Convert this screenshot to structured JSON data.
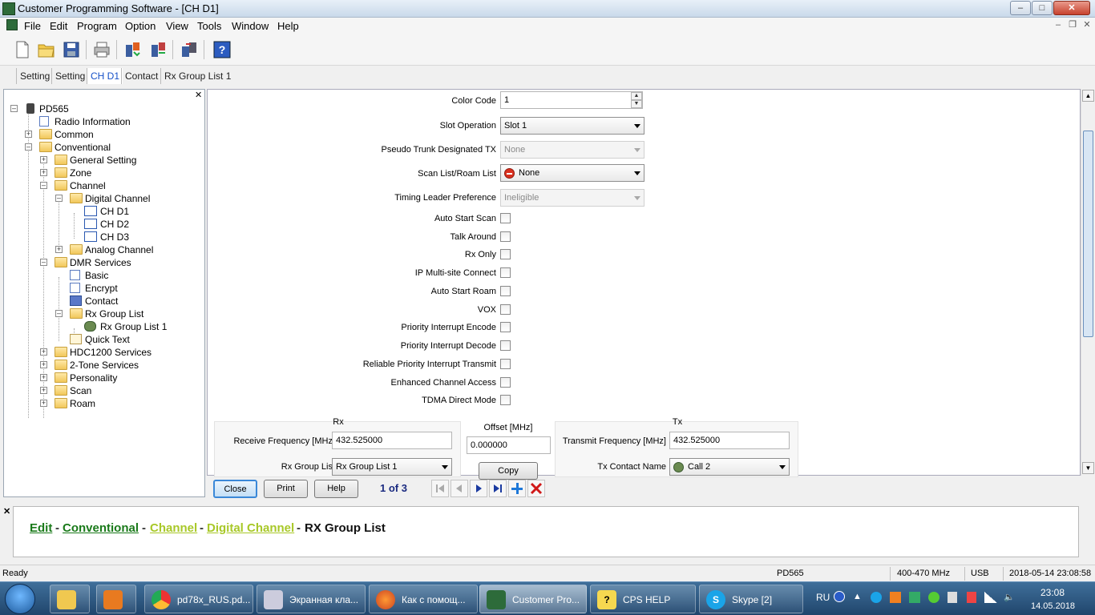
{
  "window": {
    "title": "Customer Programming Software - [CH D1]"
  },
  "menu": [
    "File",
    "Edit",
    "Program",
    "Option",
    "View",
    "Tools",
    "Window",
    "Help"
  ],
  "toolbar_icons": [
    "new-file-icon",
    "open-folder-icon",
    "save-icon",
    "print-icon",
    "read-radio-icon",
    "write-radio-icon",
    "clone-icon",
    "help-icon"
  ],
  "doc_tabs": [
    "Setting",
    "Setting",
    "CH D1",
    "Contact",
    "Rx Group List 1"
  ],
  "tree": {
    "root": "PD565",
    "nodes": [
      "Radio Information",
      "Common",
      "Conventional",
      "General Setting",
      "Zone",
      "Channel",
      "Digital Channel",
      "CH D1",
      "CH D2",
      "CH D3",
      "Analog Channel",
      "DMR Services",
      "Basic",
      "Encrypt",
      "Contact",
      "Rx Group List",
      "Rx Group List 1",
      "Quick Text",
      "HDC1200 Services",
      "2-Tone Services",
      "Personality",
      "Scan",
      "Roam"
    ]
  },
  "form": {
    "color_code_label": "Color Code",
    "color_code_value": "1",
    "slot_operation_label": "Slot Operation",
    "slot_operation_value": "Slot 1",
    "pseudo_trunk_label": "Pseudo Trunk Designated TX",
    "pseudo_trunk_value": "None",
    "scan_list_label": "Scan List/Roam List",
    "scan_list_value": "None",
    "timing_leader_label": "Timing Leader Preference",
    "timing_leader_value": "Ineligible",
    "checkboxes": [
      "Auto Start Scan",
      "Talk Around",
      "Rx Only",
      "IP Multi-site Connect",
      "Auto Start Roam",
      "VOX",
      "Priority Interrupt Encode",
      "Priority Interrupt Decode",
      "Reliable Priority Interrupt Transmit",
      "Enhanced Channel Access",
      "TDMA Direct Mode"
    ],
    "rx_title": "Rx",
    "rx_freq_label": "Receive Frequency [MHz]",
    "rx_freq_value": "432.525000",
    "rx_group_label": "Rx Group List",
    "rx_group_value": "Rx Group List 1",
    "offset_title": "Offset [MHz]",
    "offset_value": "0.000000",
    "copy_label": "Copy",
    "tx_title": "Tx",
    "tx_freq_label": "Transmit Frequency [MHz]",
    "tx_freq_value": "432.525000",
    "tx_contact_label": "Tx Contact Name",
    "tx_contact_value": "Call 2"
  },
  "buttons": {
    "close": "Close",
    "print": "Print",
    "help": "Help",
    "pager": "1 of 3"
  },
  "breadcrumb": {
    "edit": "Edit",
    "conventional": "Conventional",
    "channel": "Channel",
    "digital_channel": "Digital Channel",
    "current": "RX Group List",
    "sep": "-"
  },
  "status": {
    "left": "Ready",
    "model": "PD565",
    "band": "400-470 MHz",
    "port": "USB",
    "datetime": "2018-05-14 23:08:58"
  },
  "taskbar": {
    "items": [
      "pd78x_RUS.pd...",
      "Экранная кла...",
      "Как с помощ...",
      "Customer Pro...",
      "CPS HELP",
      "Skype [2]"
    ],
    "lang": "RU",
    "time": "23:08",
    "date": "14.05.2018"
  }
}
